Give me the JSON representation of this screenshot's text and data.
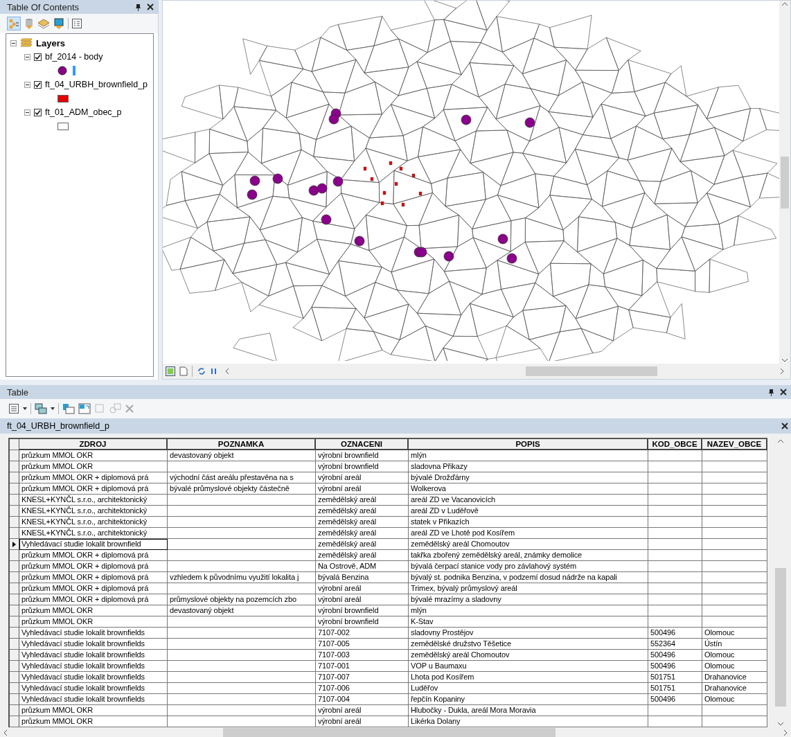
{
  "toc": {
    "title": "Table Of Contents",
    "root": {
      "label": "Layers",
      "expanded": true,
      "children": [
        {
          "label": "bf_2014 - body",
          "checked": true,
          "expanded": true,
          "legend": {
            "kind": "point",
            "color": "#8b008b"
          }
        },
        {
          "label": "ft_04_URBH_brownfield_p",
          "checked": true,
          "expanded": true,
          "legend": {
            "kind": "polygon",
            "color": "#e00000"
          }
        },
        {
          "label": "ft_01_ADM_obec_p",
          "checked": true,
          "expanded": true,
          "legend": {
            "kind": "polygon",
            "color": "#ffffff"
          }
        }
      ]
    }
  },
  "table_window": {
    "title": "Table",
    "tab": "ft_04_URBH_brownfield_p",
    "columns": [
      "ZDROJ",
      "POZNAMKA",
      "OZNACENI",
      "POPIS",
      "KOD_OBCE",
      "NAZEV_OBCE"
    ],
    "rows": [
      {
        "selected": false,
        "cells": [
          "průzkum MMOL OKR",
          "devastovaný objekt",
          "výrobní brownfield",
          "mlýn",
          "",
          ""
        ]
      },
      {
        "selected": false,
        "cells": [
          "průzkum MMOL OKR",
          "",
          "výrobní brownfield",
          "sladovna Přikazy",
          "",
          ""
        ]
      },
      {
        "selected": false,
        "cells": [
          "průzkum MMOL OKR + diplomová prá",
          "východní část areálu přestavěna na s",
          "výrobní areál",
          "bývalé Drožďárny",
          "",
          ""
        ]
      },
      {
        "selected": false,
        "cells": [
          "průzkum MMOL OKR + diplomová prá",
          "bývalé průmyslové objekty částečně",
          "výrobní areál",
          "Wolkerova",
          "",
          ""
        ]
      },
      {
        "selected": false,
        "cells": [
          "KNESL+KYNČL s.r.o., architektonický",
          "",
          "zemědělský areál",
          "areál ZD ve Vacanovicích",
          "",
          ""
        ]
      },
      {
        "selected": false,
        "cells": [
          "KNESL+KYNČL s.r.o., architektonický",
          "",
          "zemědělský areál",
          "areál ZD v Luděřově",
          "",
          ""
        ]
      },
      {
        "selected": false,
        "cells": [
          "KNESL+KYNČL s.r.o., architektonický",
          "",
          "zemědělský areál",
          "statek v Přikazích",
          "",
          ""
        ]
      },
      {
        "selected": false,
        "cells": [
          "KNESL+KYNČL s.r.o., architektonický",
          "",
          "zemědělský areál",
          "areál ZD ve Lhotě pod Kosířem",
          "",
          ""
        ]
      },
      {
        "selected": true,
        "cells": [
          "Vyhledávací studie lokalit brownfield",
          "",
          "zemědělský areál",
          "zemědělský areál Chomoutov",
          "",
          ""
        ]
      },
      {
        "selected": false,
        "cells": [
          "průzkum MMOL OKR + diplomová prá",
          "",
          "zemědělský areál",
          "takřka zbořený zemědělský areál, známky demolice",
          "",
          ""
        ]
      },
      {
        "selected": false,
        "cells": [
          "průzkum MMOL OKR + diplomová prá",
          "",
          "Na Ostrově,  ADM",
          "bývalá čerpací stanice vody pro závlahový systém",
          "",
          ""
        ]
      },
      {
        "selected": false,
        "cells": [
          "průzkum MMOL OKR + diplomová prá",
          "vzhledem k původnímu využití lokalita j",
          "bývalá Benzina",
          "bývalý st. podnika Benzina, v podzemí dosud nádrže na kapali",
          "",
          ""
        ]
      },
      {
        "selected": false,
        "cells": [
          "průzkum MMOL OKR + diplomová prá",
          "",
          "výrobní areál",
          "Trimex, bývalý průmyslový areál",
          "",
          ""
        ]
      },
      {
        "selected": false,
        "cells": [
          "průzkum MMOL OKR + diplomová prá",
          "průmyslové objekty na pozemcích zbo",
          "výrobní areál",
          "bývalé mrazírny a sladovny",
          "",
          ""
        ]
      },
      {
        "selected": false,
        "cells": [
          "průzkum MMOL OKR",
          "devastovaný objekt",
          "výrobní brownfield",
          "mlýn",
          "",
          ""
        ]
      },
      {
        "selected": false,
        "cells": [
          "průzkum MMOL OKR",
          "",
          "výrobní brownfield",
          "K-Stav",
          "",
          ""
        ]
      },
      {
        "selected": false,
        "cells": [
          "Vyhledávací studie lokalit brownfields",
          "",
          "7107-002",
          "sladovny Prostějov",
          "500496",
          "Olomouc"
        ]
      },
      {
        "selected": false,
        "cells": [
          "Vyhledávací studie lokalit brownfields",
          "",
          "7107-005",
          "zemědělské družstvo Těšetice",
          "552364",
          "Ústín"
        ]
      },
      {
        "selected": false,
        "cells": [
          "Vyhledávací studie lokalit brownfields",
          "",
          "7107-003",
          "zemědělský areál Chomoutov",
          "500496",
          "Olomouc"
        ]
      },
      {
        "selected": false,
        "cells": [
          "Vyhledávací studie lokalit brownfields",
          "",
          "7107-001",
          "VOP u Baumaxu",
          "500496",
          "Olomouc"
        ]
      },
      {
        "selected": false,
        "cells": [
          "Vyhledávací studie lokalit brownfields",
          "",
          "7107-007",
          "Lhota pod Kosířem",
          "501751",
          "Drahanovice"
        ]
      },
      {
        "selected": false,
        "cells": [
          "Vyhledávací studie lokalit brownfields",
          "",
          "7107-006",
          "Luděřov",
          "501751",
          "Drahanovice"
        ]
      },
      {
        "selected": false,
        "cells": [
          "Vyhledávací studie lokalit brownfields",
          "",
          "7107-004",
          "řepčín Kopaniny",
          "500496",
          "Olomouc"
        ]
      },
      {
        "selected": false,
        "cells": [
          "průzkum MMOL OKR",
          "",
          "výrobní areál",
          "Hlubočky - Dukla, areál Mora Moravia",
          "",
          ""
        ]
      },
      {
        "selected": false,
        "cells": [
          "průzkum MMOL OKR",
          "",
          "výrobní areál",
          "Likérka Dolany",
          "",
          ""
        ]
      }
    ]
  }
}
